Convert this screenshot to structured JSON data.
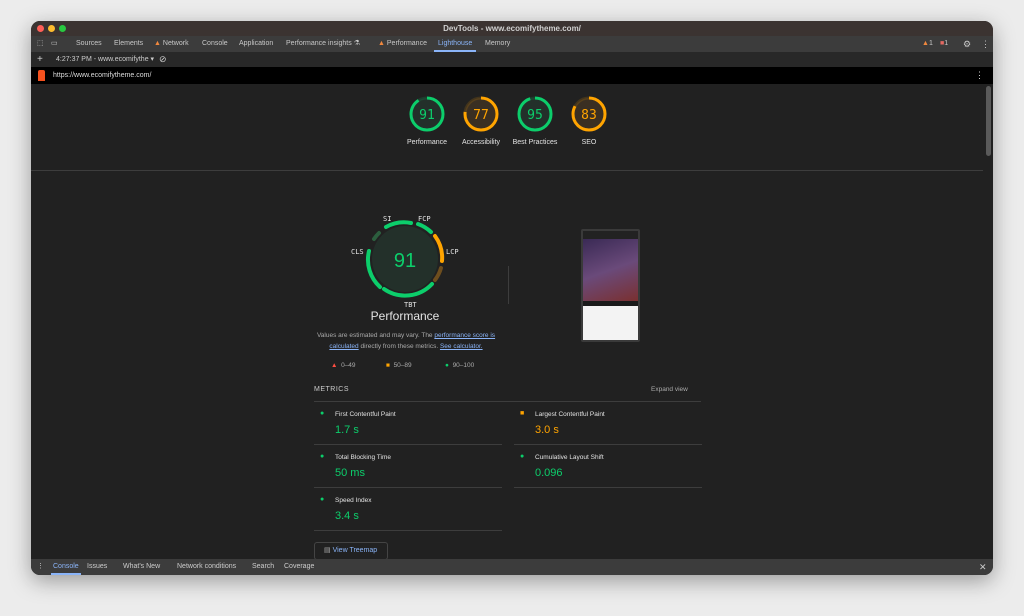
{
  "window": {
    "title": "DevTools - www.ecomifytheme.com/"
  },
  "tabs": [
    {
      "label": "Sources"
    },
    {
      "label": "Elements"
    },
    {
      "label": "Network",
      "warning": true
    },
    {
      "label": "Console"
    },
    {
      "label": "Application"
    },
    {
      "label": "Performance insights ⚗"
    },
    {
      "label": "Performance",
      "warning": true
    },
    {
      "label": "Lighthouse",
      "active": true
    },
    {
      "label": "Memory"
    }
  ],
  "status": {
    "warnings": "1",
    "errors": "1"
  },
  "toolbar": {
    "report": "4:27:37 PM - www.ecomifythe"
  },
  "url": "https://www.ecomifytheme.com/",
  "scores": [
    {
      "label": "Performance",
      "value": 91,
      "color": "#0cce6b"
    },
    {
      "label": "Accessibility",
      "value": 77,
      "color": "#ffa400"
    },
    {
      "label": "Best Practices",
      "value": 95,
      "color": "#0cce6b"
    },
    {
      "label": "SEO",
      "value": 83,
      "color": "#ffa400"
    }
  ],
  "gauge": {
    "value": "91",
    "title": "Performance",
    "labels": {
      "si": "SI",
      "fcp": "FCP",
      "cls": "CLS",
      "lcp": "LCP",
      "tbt": "TBT"
    }
  },
  "note": {
    "pre": "Values are estimated and may vary. The ",
    "link1": "performance score is calculated",
    "mid": " directly from these metrics. ",
    "link2": "See calculator."
  },
  "legend": {
    "fail": "0–49",
    "average": "50–89",
    "pass": "90–100"
  },
  "metrics": {
    "header": "METRICS",
    "expand": "Expand view",
    "items": [
      {
        "name": "First Contentful Paint",
        "value": "1.7 s",
        "status": "pass"
      },
      {
        "name": "Largest Contentful Paint",
        "value": "3.0 s",
        "status": "average"
      },
      {
        "name": "Total Blocking Time",
        "value": "50 ms",
        "status": "pass"
      },
      {
        "name": "Cumulative Layout Shift",
        "value": "0.096",
        "status": "pass"
      },
      {
        "name": "Speed Index",
        "value": "3.4 s",
        "status": "pass"
      }
    ]
  },
  "treemap": "View Treemap",
  "drawer": [
    {
      "label": "Console",
      "active": true
    },
    {
      "label": "Issues"
    },
    {
      "label": "What's New"
    },
    {
      "label": "Network conditions"
    },
    {
      "label": "Search"
    },
    {
      "label": "Coverage"
    }
  ],
  "colors": {
    "pass": "#0cce6b",
    "average": "#ffa400",
    "fail": "#ff4e42",
    "accent": "#8ab4f8"
  }
}
